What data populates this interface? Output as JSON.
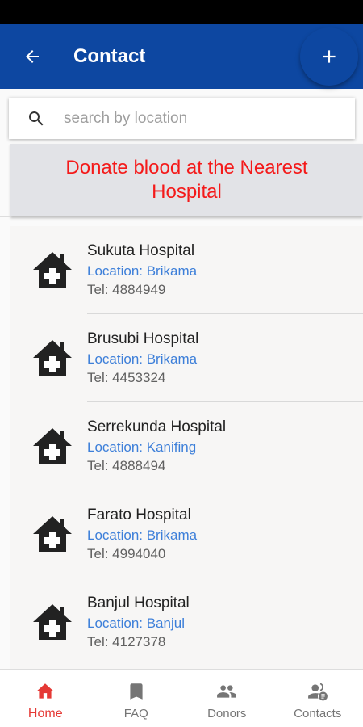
{
  "app_bar": {
    "title": "Contact",
    "background": "#0d47a1"
  },
  "search": {
    "placeholder": "search by location",
    "value": ""
  },
  "banner": {
    "text": "Donate blood at the Nearest Hospital",
    "color": "#f41a1a"
  },
  "hospitals": [
    {
      "name": "Sukuta Hospital",
      "location": "Location: Brikama",
      "tel": "Tel: 4884949"
    },
    {
      "name": "Brusubi Hospital",
      "location": "Location: Brikama",
      "tel": "Tel: 4453324"
    },
    {
      "name": "Serrekunda Hospital",
      "location": "Location: Kanifing",
      "tel": "Tel: 4888494"
    },
    {
      "name": "Farato Hospital",
      "location": "Location: Brikama",
      "tel": "Tel: 4994040"
    },
    {
      "name": "Banjul Hospital",
      "location": "Location: Banjul",
      "tel": "Tel: 4127378"
    }
  ],
  "bottom_nav": {
    "items": [
      {
        "label": "Home",
        "icon": "home-icon",
        "active": true
      },
      {
        "label": "FAQ",
        "icon": "bookmark-icon",
        "active": false
      },
      {
        "label": "Donors",
        "icon": "people-icon",
        "active": false
      },
      {
        "label": "Contacts",
        "icon": "contacts-icon",
        "active": false
      }
    ],
    "active_color": "#e53935"
  }
}
